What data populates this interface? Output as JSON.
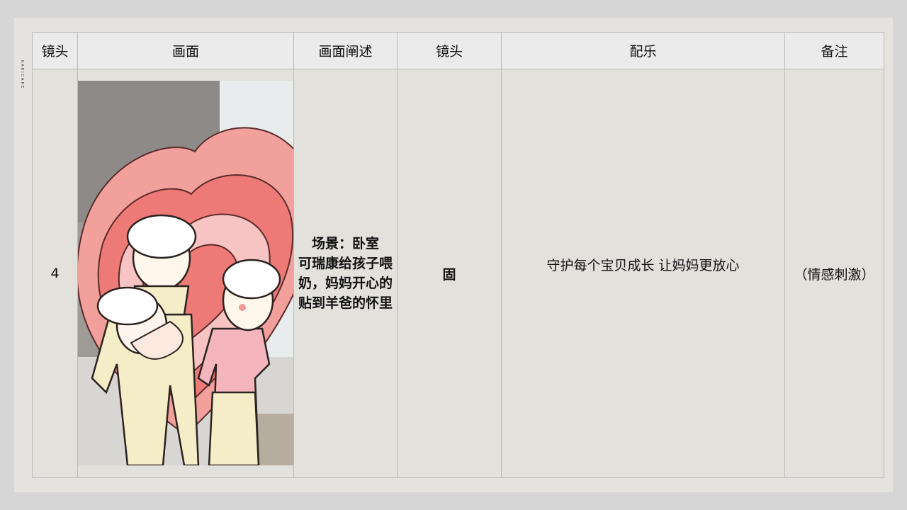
{
  "side_logo": "KARICARE",
  "headers": {
    "shot_no": "镜头",
    "frame": "画面",
    "frame_desc": "画面阐述",
    "shot_type": "镜头",
    "music": "配乐",
    "notes": "备注"
  },
  "row": {
    "shot_no": "4",
    "desc_lines": [
      "场景：卧室",
      "可瑞康给孩子喂",
      "奶，妈妈开心的",
      "贴到羊爸的怀里"
    ],
    "shot_type": "固",
    "music": "守护每个宝贝成长 让妈妈更放心",
    "notes": "（情感刺激）"
  },
  "colors": {
    "page_bg": "#d6d6d6",
    "slide_bg": "#e4e3df",
    "header_bg": "#ebebeb",
    "heart_outer": "#f2a09c",
    "heart_mid": "#ee7a77",
    "heart_light": "#f7c4c3",
    "character_cream": "#f5edc8",
    "mom_shirt": "#f5b5bd"
  }
}
